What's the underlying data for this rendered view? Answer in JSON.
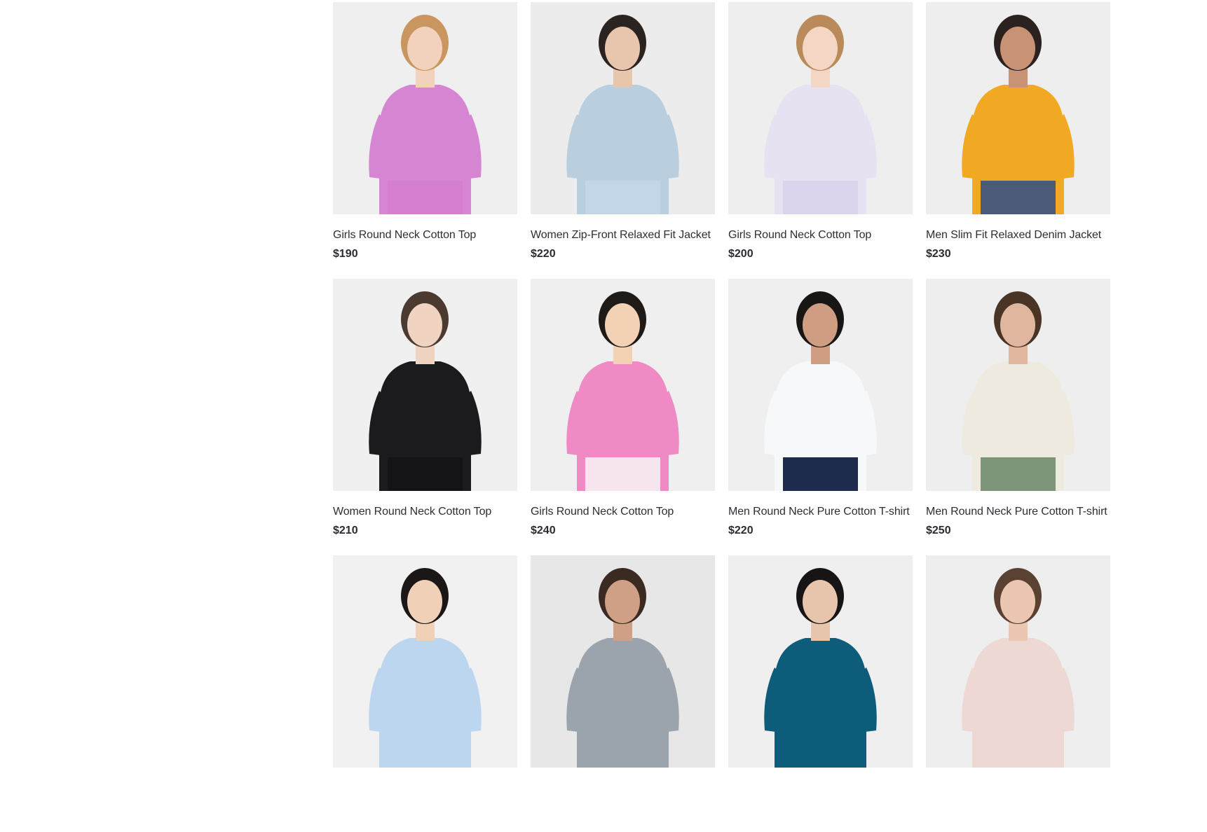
{
  "products": [
    {
      "name": "Girls Round Neck Cotton Top",
      "price": "$190",
      "bg": "#efefef",
      "garment": "#d685d3",
      "skin": "#f3d2bd",
      "hair": "#c8965e",
      "bottom": "#d67fd1"
    },
    {
      "name": "Women Zip-Front Relaxed Fit Jacket",
      "price": "$220",
      "bg": "#ececec",
      "garment": "#b9cfe0",
      "skin": "#e8c5ad",
      "hair": "#2a2320",
      "bottom": "#c3d6e8"
    },
    {
      "name": "Girls Round Neck Cotton Top",
      "price": "$200",
      "bg": "#eeeeee",
      "garment": "#e6e2f1",
      "skin": "#f4d6c4",
      "hair": "#b98a5a",
      "bottom": "#dcd4ec"
    },
    {
      "name": "Men Slim Fit Relaxed Denim Jacket",
      "price": "$230",
      "bg": "#eeeeee",
      "garment": "#f1a923",
      "skin": "#c89374",
      "hair": "#2b2220",
      "bottom": "#4a5a78"
    },
    {
      "name": "Women Round Neck Cotton Top",
      "price": "$210",
      "bg": "#f0f0f0",
      "garment": "#1b1b1d",
      "skin": "#f1d3c2",
      "hair": "#4a3a30",
      "bottom": "#141416"
    },
    {
      "name": "Girls Round Neck Cotton Top",
      "price": "$240",
      "bg": "#efefef",
      "garment": "#f08ac4",
      "skin": "#f3d1b5",
      "hair": "#1e1a18",
      "bottom": "#f6e5ef"
    },
    {
      "name": "Men Round Neck Pure Cotton T-shirt",
      "price": "$220",
      "bg": "#efefef",
      "garment": "#f7f8f9",
      "skin": "#cf9e82",
      "hair": "#181515",
      "bottom": "#1f2b4d"
    },
    {
      "name": "Men Round Neck Pure Cotton T-shirt",
      "price": "$250",
      "bg": "#eeeeee",
      "garment": "#eeeae0",
      "skin": "#e0b79e",
      "hair": "#4a3426",
      "bottom": "#7d9578"
    },
    {
      "name": "",
      "price": "",
      "bg": "#f1f1f1",
      "garment": "#bcd6ef",
      "skin": "#f1d0b8",
      "hair": "#1a1716",
      "bottom": "#bcd6ef"
    },
    {
      "name": "",
      "price": "",
      "bg": "#e7e7e7",
      "garment": "#9ba3ad",
      "skin": "#cf9f86",
      "hair": "#3a2a22",
      "bottom": "#9ba3ad"
    },
    {
      "name": "",
      "price": "",
      "bg": "#efefef",
      "garment": "#0c5c7a",
      "skin": "#e7c5ad",
      "hair": "#161414",
      "bottom": "#0c5c7a"
    },
    {
      "name": "",
      "price": "",
      "bg": "#eeeeee",
      "garment": "#edd8d4",
      "skin": "#ebc6b1",
      "hair": "#5a4132",
      "bottom": "#edd8d4"
    }
  ]
}
